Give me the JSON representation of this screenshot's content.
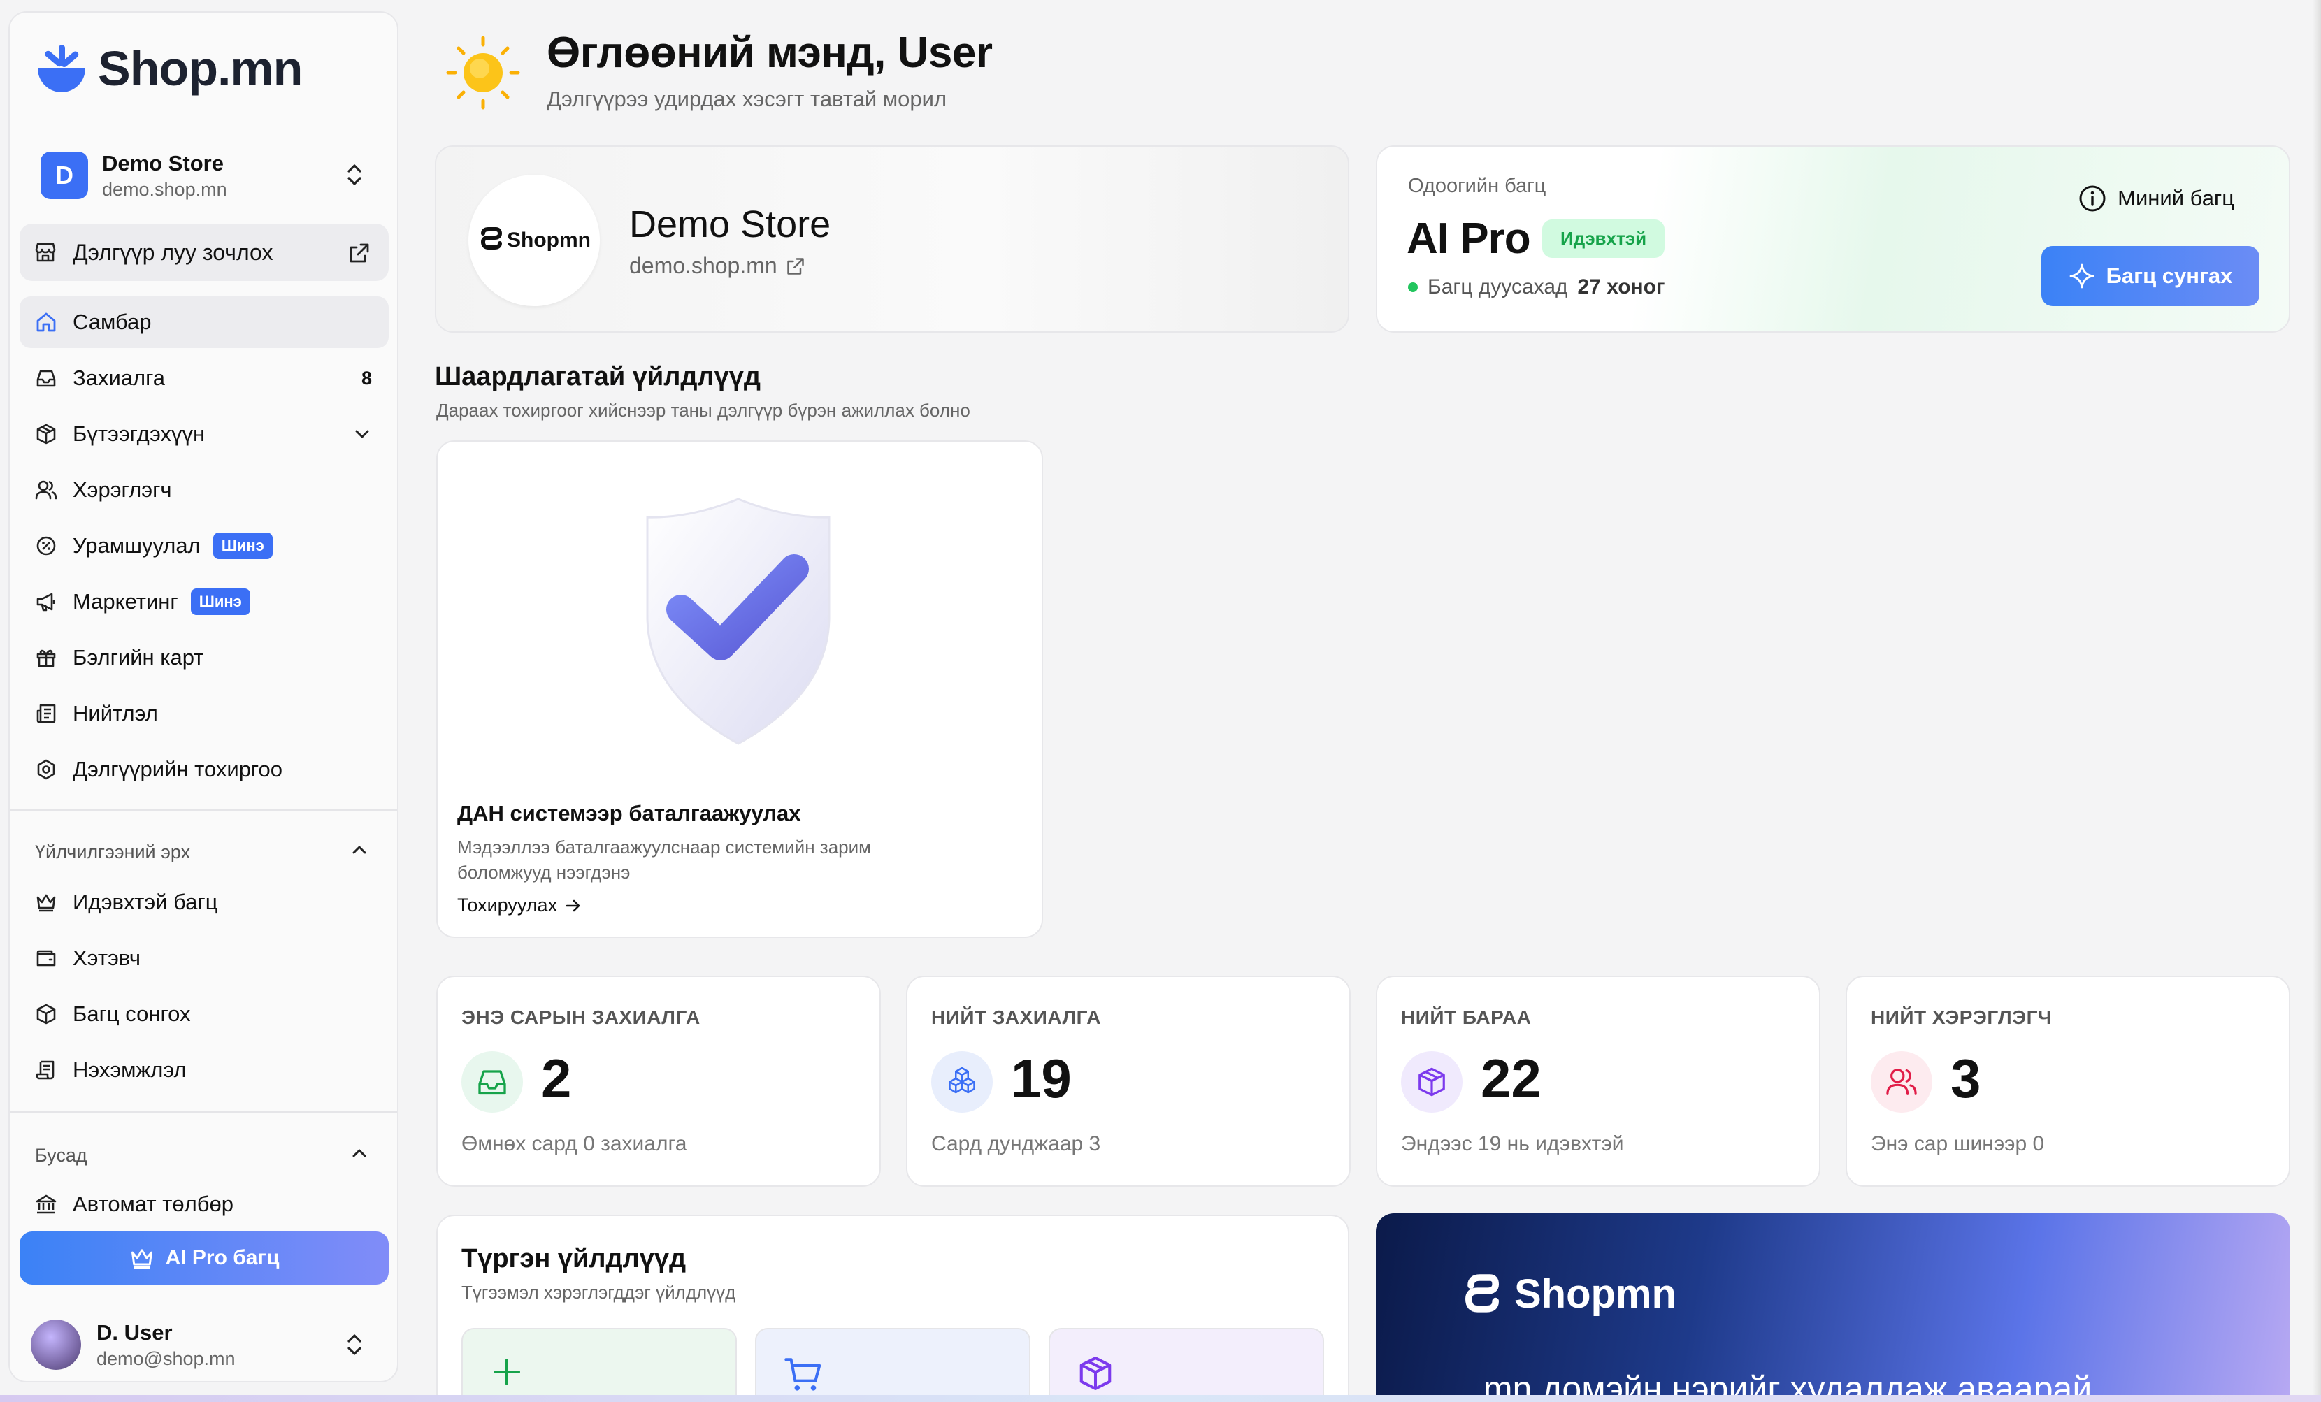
{
  "app": {
    "brand": "Shop.mn"
  },
  "sidebar": {
    "store": {
      "initial": "D",
      "name": "Demo Store",
      "domain": "demo.shop.mn"
    },
    "goto_store": "Дэлгүүр луу зочлох",
    "items": [
      {
        "label": "Самбар",
        "icon": "home-icon",
        "active": true
      },
      {
        "label": "Захиалга",
        "icon": "inbox-icon",
        "count": "8"
      },
      {
        "label": "Бүтээгдэхүүн",
        "icon": "box-icon"
      },
      {
        "label": "Хэрэглэгч",
        "icon": "users-icon"
      },
      {
        "label": "Урамшуулал",
        "icon": "discount-icon",
        "badge": "Шинэ"
      },
      {
        "label": "Маркетинг",
        "icon": "megaphone-icon",
        "badge": "Шинэ"
      },
      {
        "label": "Бэлгийн карт",
        "icon": "gift-icon"
      },
      {
        "label": "Нийтлэл",
        "icon": "newspaper-icon"
      },
      {
        "label": "Дэлгүүрийн тохиргоо",
        "icon": "settings-icon"
      }
    ],
    "section_service": "Үйлчилгээний эрх",
    "service_items": [
      {
        "label": "Идэвхтэй багц",
        "icon": "crown-icon"
      },
      {
        "label": "Хэтэвч",
        "icon": "wallet-icon"
      },
      {
        "label": "Багц сонгох",
        "icon": "box-icon"
      },
      {
        "label": "Нэхэмжлэл",
        "icon": "receipt-icon"
      }
    ],
    "section_other": "Бусад",
    "other_items": [
      {
        "label": "Автомат төлбөр",
        "icon": "bank-icon"
      }
    ],
    "ai_button": "AI Pro багц",
    "user": {
      "name": "D. User",
      "email": "demo@shop.mn"
    }
  },
  "header": {
    "title": "Өглөөний мэнд, User",
    "subtitle": "Дэлгүүрээ удирдах хэсэгт тавтай морил"
  },
  "store_card": {
    "logo_text": "Shopmn",
    "name": "Demo Store",
    "url": "demo.shop.mn"
  },
  "plan_card": {
    "label": "Одоогийн багц",
    "name": "AI Pro",
    "status": "Идэвхтэй",
    "days_prefix": "Багц дуусахад",
    "days_value": "27 хоног",
    "my_plan": "Миний багц",
    "extend": "Багц сунгах"
  },
  "required": {
    "title": "Шаардлагатай үйлдлүүд",
    "subtitle": "Дараах тохиргоог хийснээр таны дэлгүүр бүрэн ажиллах болно",
    "card": {
      "title": "ДАН системээр баталгаажуулах",
      "desc": "Мэдээллээ баталгаажуулснаар системийн зарим боломжууд нээгдэнэ",
      "link": "Тохируулах"
    }
  },
  "stats": [
    {
      "label": "ЭНЭ САРЫН ЗАХИАЛГА",
      "value": "2",
      "sub": "Өмнөх сард 0 захиалга",
      "icon": "inbox-icon",
      "color": "#16a34a",
      "bg": "#e8f7ee"
    },
    {
      "label": "НИЙТ ЗАХИАЛГА",
      "value": "19",
      "sub": "Сард дунджаар 3",
      "icon": "boxes-icon",
      "color": "#3b6ff5",
      "bg": "#e8eefc"
    },
    {
      "label": "НИЙТ БАРАА",
      "value": "22",
      "sub": "Эндээс 19 нь идэвхтэй",
      "icon": "box-icon",
      "color": "#7c3aed",
      "bg": "#f0eafd"
    },
    {
      "label": "НИЙТ ХЭРЭГЛЭГЧ",
      "value": "3",
      "sub": "Энэ сар шинээр 0",
      "icon": "users-icon",
      "color": "#e11d48",
      "bg": "#fdebef"
    }
  ],
  "quick": {
    "title": "Түргэн үйлдлүүд",
    "subtitle": "Түгээмэл хэрэглэгддэг үйлдлүүд",
    "tiles": [
      {
        "icon": "plus-icon",
        "color": "#16a34a",
        "bg": "#ecf7ef"
      },
      {
        "icon": "cart-icon",
        "color": "#3b6ff5",
        "bg": "#edf1fc"
      },
      {
        "icon": "box-icon",
        "color": "#7c3aed",
        "bg": "#f3eefc"
      }
    ]
  },
  "promo": {
    "brand": "Shopmn",
    "text": ".mn домэйн нэрийг худалдаж аваарай"
  }
}
